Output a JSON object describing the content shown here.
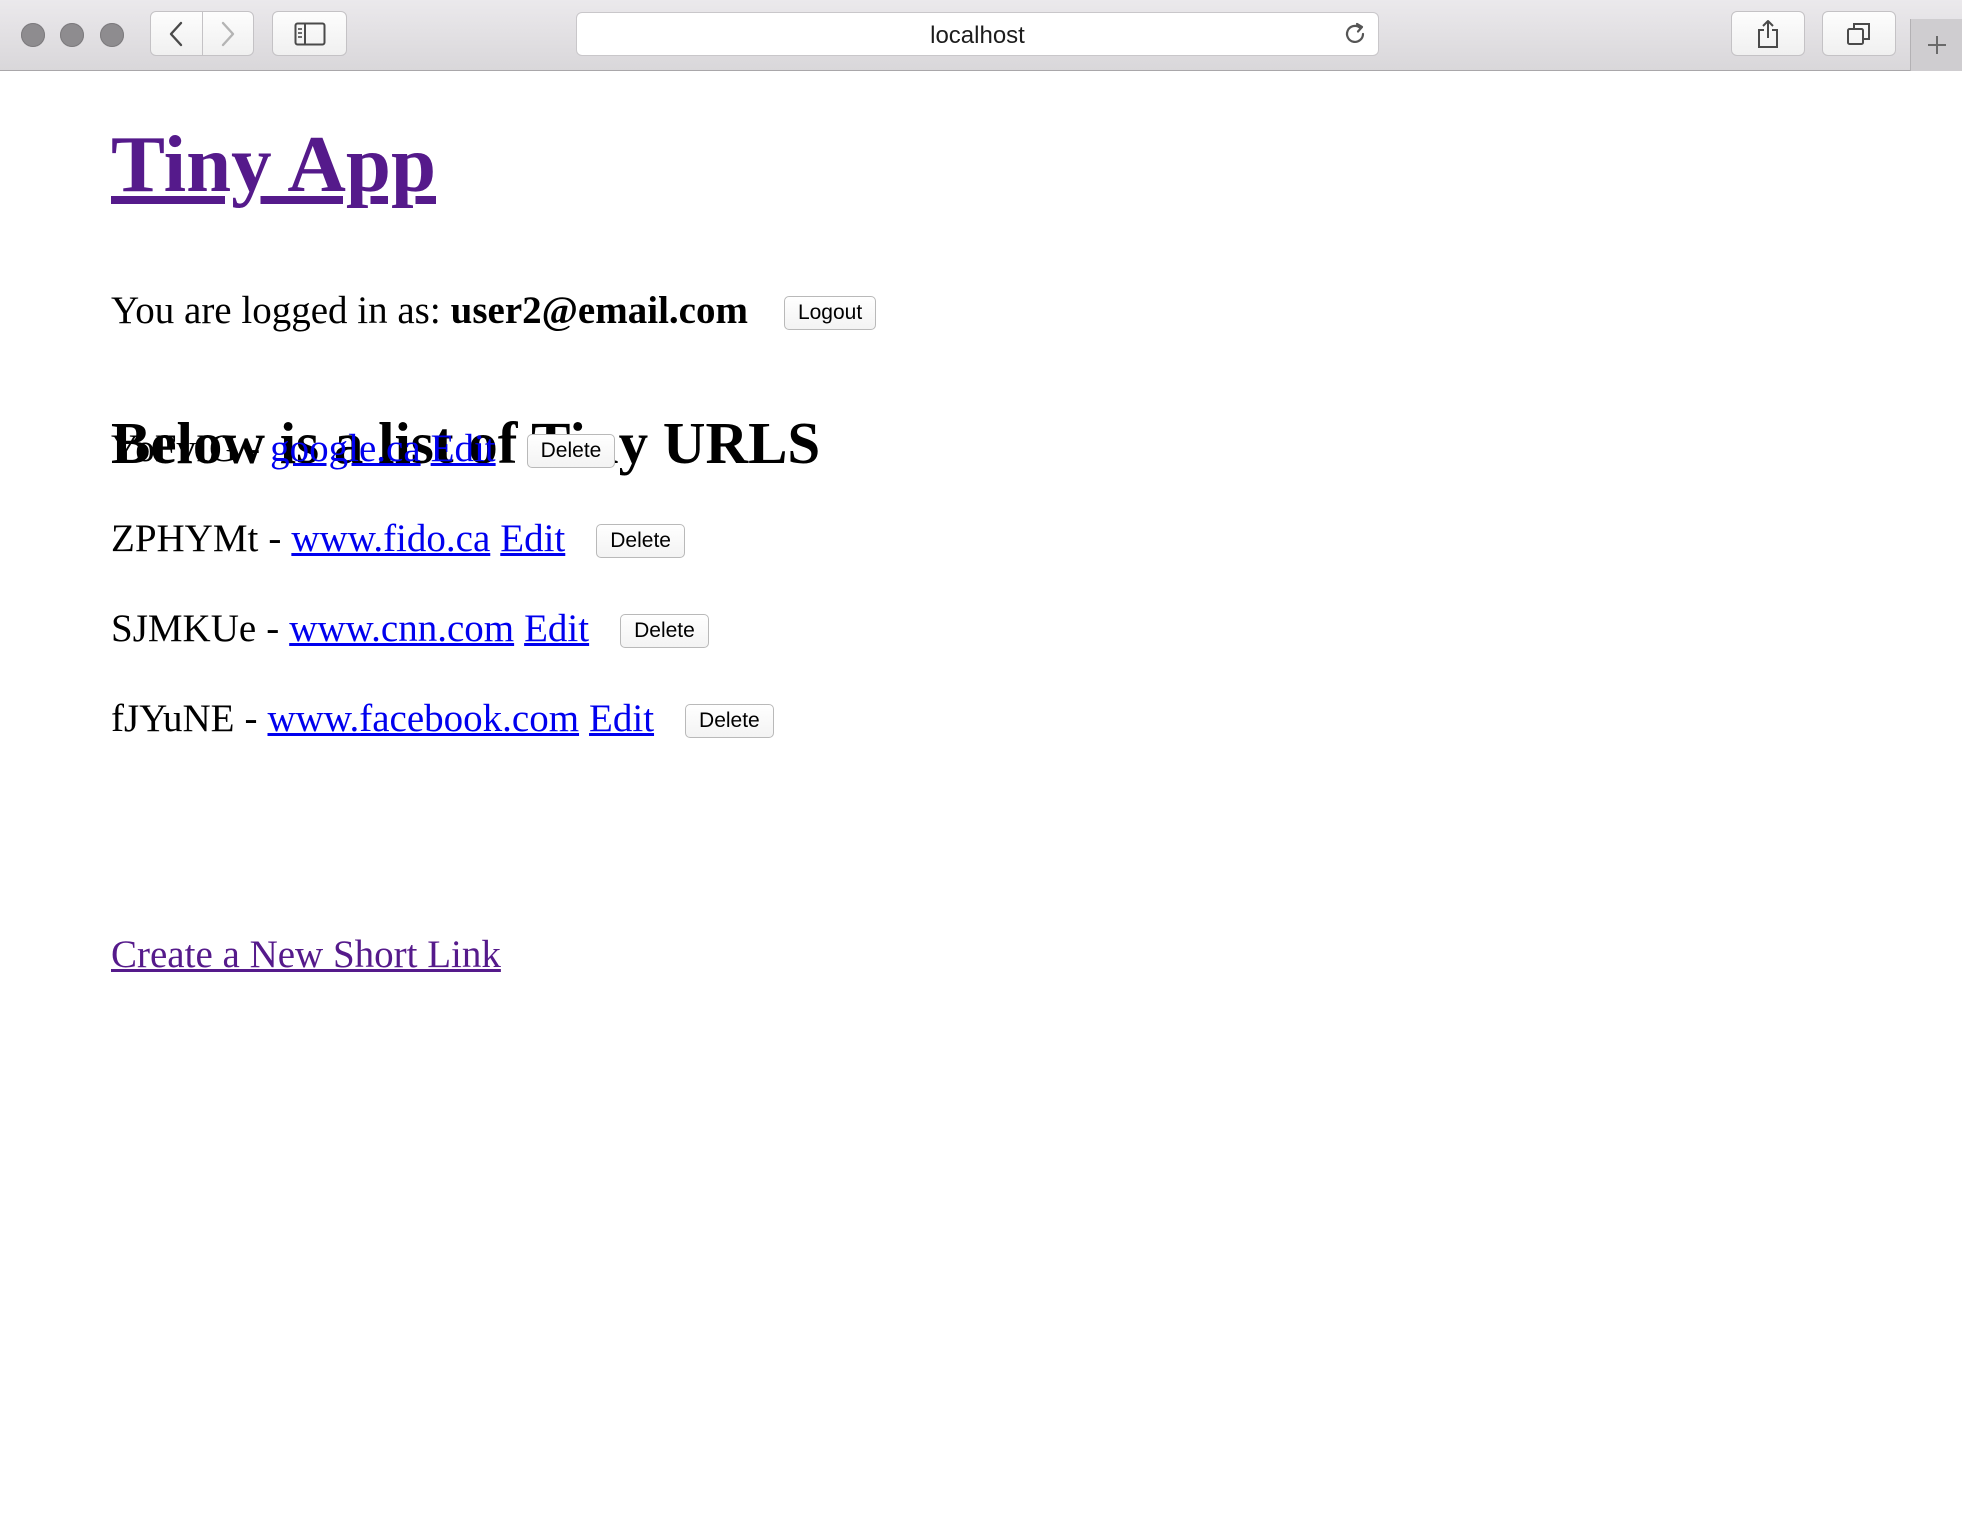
{
  "browser": {
    "address": "localhost"
  },
  "app": {
    "title": "Tiny App"
  },
  "login": {
    "prefix": "You are logged in as:",
    "email": "user2@email.com",
    "logout_label": "Logout"
  },
  "urls": {
    "heading": "Below is a list of Tiny URLS",
    "separator": "-",
    "edit_label": "Edit",
    "delete_label": "Delete",
    "items": [
      {
        "short": "YoFvIG",
        "long": "google.ca"
      },
      {
        "short": "ZPHYMt",
        "long": "www.fido.ca"
      },
      {
        "short": "SJMKUe",
        "long": "www.cnn.com"
      },
      {
        "short": "fJYuNE",
        "long": "www.facebook.com"
      }
    ]
  },
  "create_link": "Create a New Short Link",
  "colors": {
    "visited_link": "#551a8b",
    "link": "#0000ee"
  }
}
